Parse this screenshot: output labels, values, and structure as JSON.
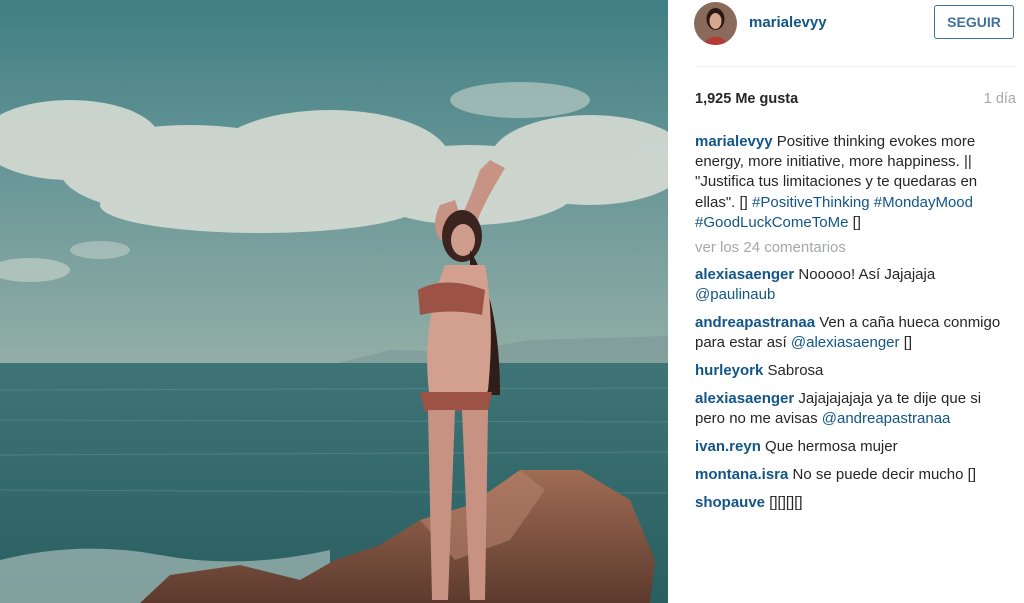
{
  "post": {
    "username": "marialevyy",
    "follow_label": "SEGUIR",
    "likes": "1,925 Me gusta",
    "age": "1 día",
    "caption": {
      "user": "marialevyy",
      "text": "Positive thinking evokes more energy, more initiative, more happiness. || \"Justifica tus limitaciones y te quedaras en ellas\". []",
      "tags": [
        "#PositiveThinking",
        "#MondayMood",
        "#GoodLuckComeToMe"
      ],
      "tail": "[]"
    },
    "view_all": "ver los 24 comentarios",
    "comments": [
      {
        "user": "alexiasaenger",
        "text": "Nooooo! Así Jajajaja",
        "mention": "@paulinaub",
        "tail": ""
      },
      {
        "user": "andreapastranaa",
        "text": "Ven a caña hueca conmigo para estar así",
        "mention": "@alexiasaenger",
        "tail": "[]"
      },
      {
        "user": "hurleyork",
        "text": "Sabrosa",
        "mention": "",
        "tail": ""
      },
      {
        "user": "alexiasaenger",
        "text": "Jajajajajaja ya te dije que si pero no me avisas",
        "mention": "@andreapastranaa",
        "tail": ""
      },
      {
        "user": "ivan.reyn",
        "text": "Que hermosa mujer",
        "mention": "",
        "tail": ""
      },
      {
        "user": "montana.isra",
        "text": "No se puede decir mucho []",
        "mention": "",
        "tail": ""
      },
      {
        "user": "shopauve",
        "text": "[][][][]",
        "mention": "",
        "tail": ""
      }
    ]
  },
  "colors": {
    "username": "#125688",
    "follow_border": "#3f729b",
    "muted": "#a5a7aa",
    "text": "#262626",
    "sky": "#5c8b8f",
    "sea": "#2f6c70"
  }
}
